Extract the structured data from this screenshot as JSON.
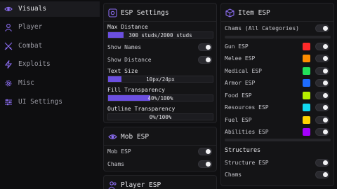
{
  "sidebar": {
    "items": [
      {
        "label": "Visuals",
        "icon": "eye-icon",
        "active": true
      },
      {
        "label": "Player",
        "icon": "user-icon",
        "active": false
      },
      {
        "label": "Combat",
        "icon": "swords-icon",
        "active": false
      },
      {
        "label": "Exploits",
        "icon": "lightning-icon",
        "active": false
      },
      {
        "label": "Misc",
        "icon": "gear-icon",
        "active": false
      },
      {
        "label": "UI Settings",
        "icon": "sliders-icon",
        "active": false
      }
    ]
  },
  "esp_settings": {
    "title": "ESP Settings",
    "icon": "cog-box-icon",
    "max_distance": {
      "label": "Max Distance",
      "value": "300 studs/2000 studs",
      "fraction": 0.15
    },
    "show_names": {
      "label": "Show Names"
    },
    "show_distance": {
      "label": "Show Distance"
    },
    "text_size": {
      "label": "Text Size",
      "value": "10px/24px",
      "fraction": 0.13
    },
    "fill_transparency": {
      "label": "Fill Transparency",
      "value": "40%/100%",
      "fraction": 0.4
    },
    "outline_transparency": {
      "label": "Outline Transparency",
      "value": "0%/100%",
      "fraction": 0.0
    }
  },
  "mob_esp": {
    "title": "Mob ESP",
    "icon": "eye-icon",
    "items": [
      {
        "label": "Mob ESP"
      },
      {
        "label": "Chams"
      }
    ]
  },
  "player_esp": {
    "title": "Player ESP",
    "icon": "users-icon"
  },
  "item_esp": {
    "title": "Item ESP",
    "icon": "cube-icon",
    "chams_all": {
      "label": "Chams (All Categories)"
    },
    "categories": [
      {
        "label": "Gun ESP",
        "color": "#ff2a2a"
      },
      {
        "label": "Melee ESP",
        "color": "#ff8c00"
      },
      {
        "label": "Medical ESP",
        "color": "#22e05a"
      },
      {
        "label": "Armor ESP",
        "color": "#1e6cff"
      },
      {
        "label": "Food ESP",
        "color": "#b6f000"
      },
      {
        "label": "Resources ESP",
        "color": "#12d8f0"
      },
      {
        "label": "Fuel ESP",
        "color": "#ffd400"
      },
      {
        "label": "Abilities ESP",
        "color": "#a400ff"
      }
    ],
    "structures": {
      "title": "Structures",
      "items": [
        {
          "label": "Structure ESP"
        },
        {
          "label": "Chams"
        }
      ]
    }
  },
  "colors": {
    "accent": "#6b4fe0",
    "icon": "#8a6cf0"
  }
}
